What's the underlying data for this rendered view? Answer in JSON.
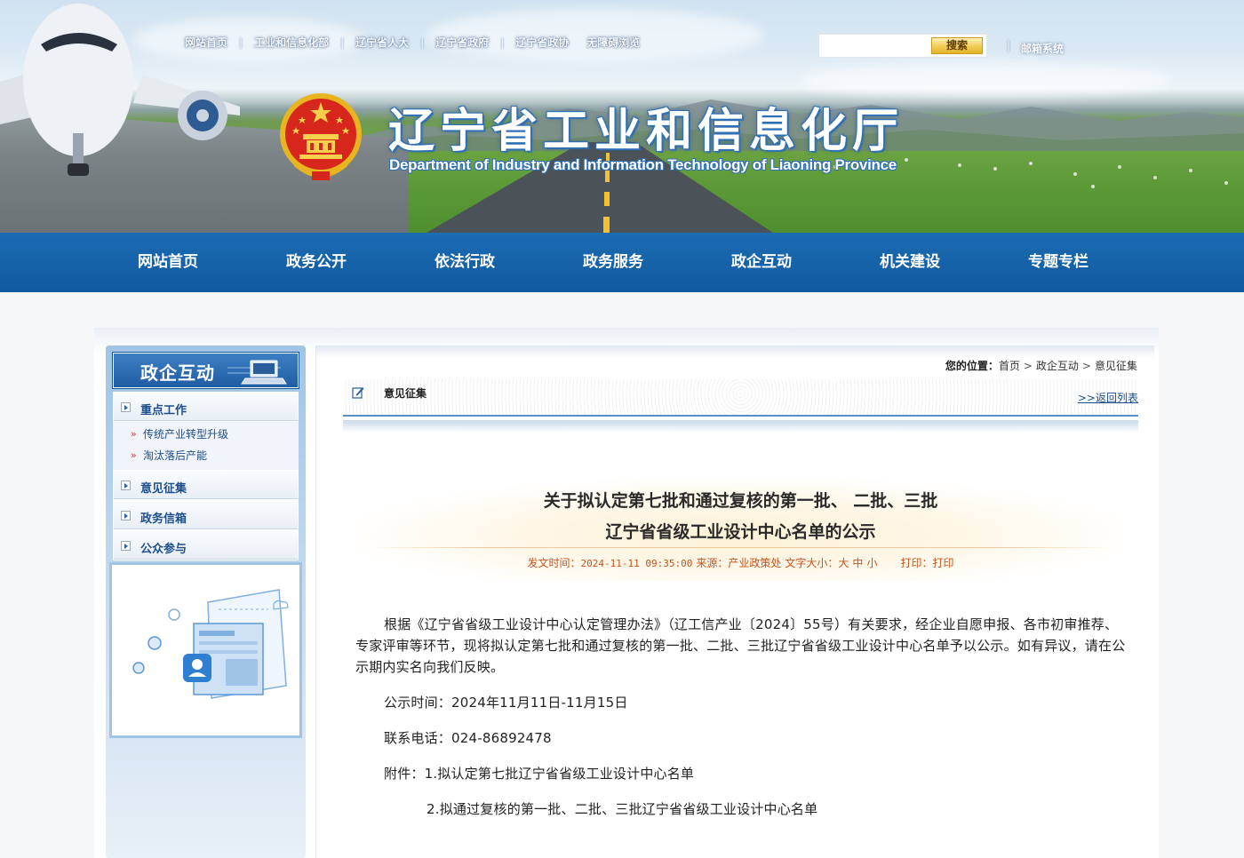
{
  "header": {
    "top_links": [
      "网站首页",
      "工业和信息化部",
      "辽宁省人大",
      "辽宁省政府",
      "辽宁省政协",
      "无障碍浏览"
    ],
    "search": {
      "placeholder": "",
      "button_label": "搜索"
    },
    "mail_link": "邮箱系统",
    "site_title": "辽宁省工业和信息化厅",
    "site_subtitle": "Department of Industry and Information Technology of Liaoning Province"
  },
  "main_nav": [
    "网站首页",
    "政务公开",
    "依法行政",
    "政务服务",
    "政企互动",
    "机关建设",
    "专题专栏"
  ],
  "sidebar": {
    "title": "政企互动",
    "categories": [
      {
        "label": "重点工作",
        "subs": [
          "传统产业转型升级",
          "淘汰落后产能"
        ]
      },
      {
        "label": "意见征集"
      },
      {
        "label": "政务信箱"
      },
      {
        "label": "公众参与"
      }
    ]
  },
  "breadcrumb": {
    "prefix": "您的位置：",
    "items": [
      "首页",
      "政企互动",
      "意见征集"
    ],
    "sep": ">"
  },
  "section": {
    "title": "意见征集",
    "back_link": ">>返回列表"
  },
  "article": {
    "title_line1": "关于拟认定第七批和通过复核的第一批、 二批、三批",
    "title_line2": "辽宁省省级工业设计中心名单的公示",
    "meta": {
      "date_label": "发文时间：",
      "date_value": "2024-11-11 09:35:00",
      "source_label": "来源：",
      "source_value": "产业政策处",
      "font_label": "文字大小：",
      "font_sizes": [
        "大",
        "中",
        "小"
      ],
      "print_label": "打印：",
      "print_link": "打印"
    },
    "paragraphs": [
      "根据《辽宁省省级工业设计中心认定管理办法》（辽工信产业〔2024〕55号）有关要求，经企业自愿申报、各市初审推荐、专家评审等环节，现将拟认定第七批和通过复核的第一批、二批、三批辽宁省省级工业设计中心名单予以公示。如有异议，请在公示期内实名向我们反映。",
      "公示时间：2024年11月11日-11月15日",
      "联系电话：024-86892478",
      "附件：1.拟认定第七批辽宁省省级工业设计中心名单",
      "2.拟通过复核的第一批、二批、三批辽宁省省级工业设计中心名单"
    ]
  },
  "colors": {
    "nav_blue": "#1464ad",
    "meta_orange": "#c4541c",
    "link_blue": "#1d4f8c"
  }
}
